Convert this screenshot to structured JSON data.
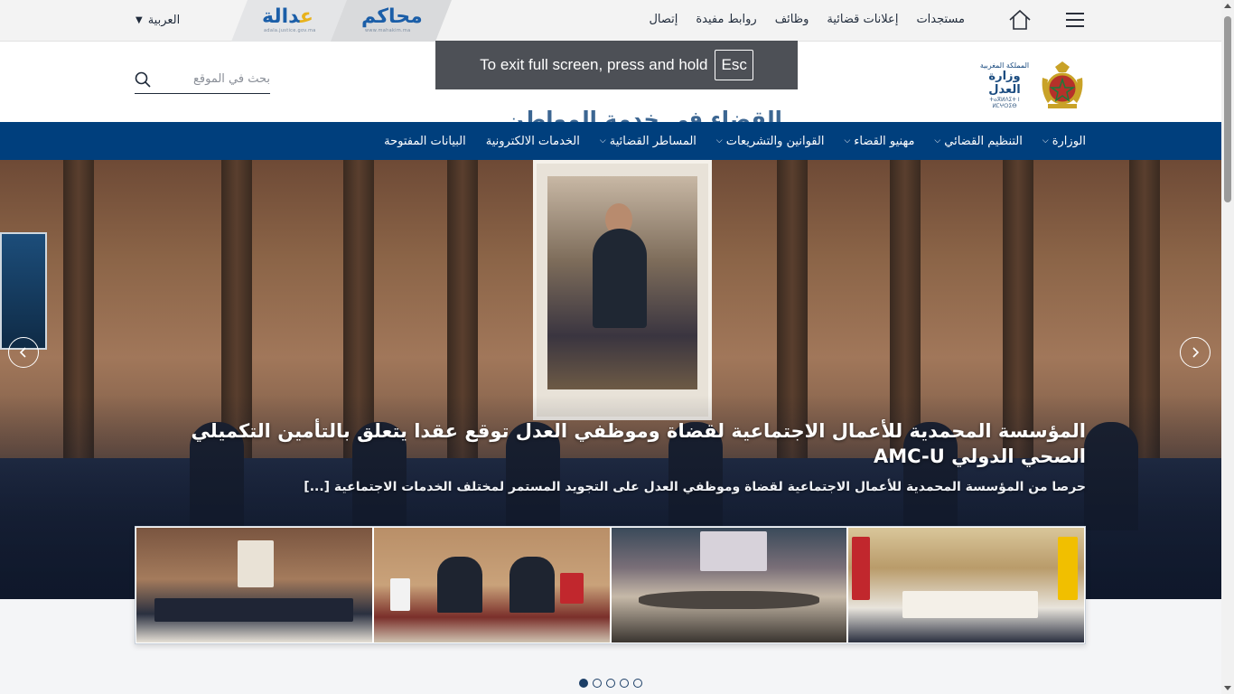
{
  "topbar": {
    "links": [
      "مستجدات",
      "إعلانات قضائية",
      "وظائف",
      "روابط مفيدة",
      "إتصال"
    ],
    "language": "العربية",
    "brand_adala": {
      "main": "عدالة",
      "sub": "adala.justice.gov.ma"
    },
    "brand_mahakim": {
      "main": "محاكم",
      "sub": "www.mahakim.ma"
    }
  },
  "header": {
    "logo_line1": "المملكة المغربية",
    "logo_line2": "وزارة العدل",
    "logo_line3": "ⵜⴰⴳⵍⴷⵉⵜ ⵏ ⵍⵎⵖⵔⵉⴱ",
    "slogan": "القضاء في خدمة المواطن",
    "search_placeholder": "بحث في الموقع"
  },
  "fullscreen_notice": {
    "text": "To exit full screen, press and hold",
    "key": "Esc"
  },
  "nav": {
    "items": [
      {
        "label": "الوزارة",
        "dropdown": true
      },
      {
        "label": "التنظيم القضائي",
        "dropdown": true
      },
      {
        "label": "مهنيو القضاء",
        "dropdown": true
      },
      {
        "label": "القوانين والتشريعات",
        "dropdown": true
      },
      {
        "label": "المساطر القضائية",
        "dropdown": true
      },
      {
        "label": "الخدمات الالكترونية",
        "dropdown": false
      },
      {
        "label": "البيانات المفتوحة",
        "dropdown": false
      }
    ]
  },
  "hero": {
    "title": "المؤسسة المحمدية للأعمال الاجتماعية لقضاة وموظفي العدل توقع عقدا يتعلق بالتأمين التكميلي الصحي الدولي AMC-U",
    "description": "حرصا من المؤسسة المحمدية للأعمال الاجتماعية لقضاة وموظفي العدل على التجويد المستمر لمختلف الخدمات الاجتماعية [...]"
  },
  "slider": {
    "total_slides": 5,
    "active_slide": 1
  },
  "colors": {
    "nav_bg": "#003f7d",
    "brand_blue": "#1b5ea8",
    "brand_gold": "#e8b21c"
  }
}
